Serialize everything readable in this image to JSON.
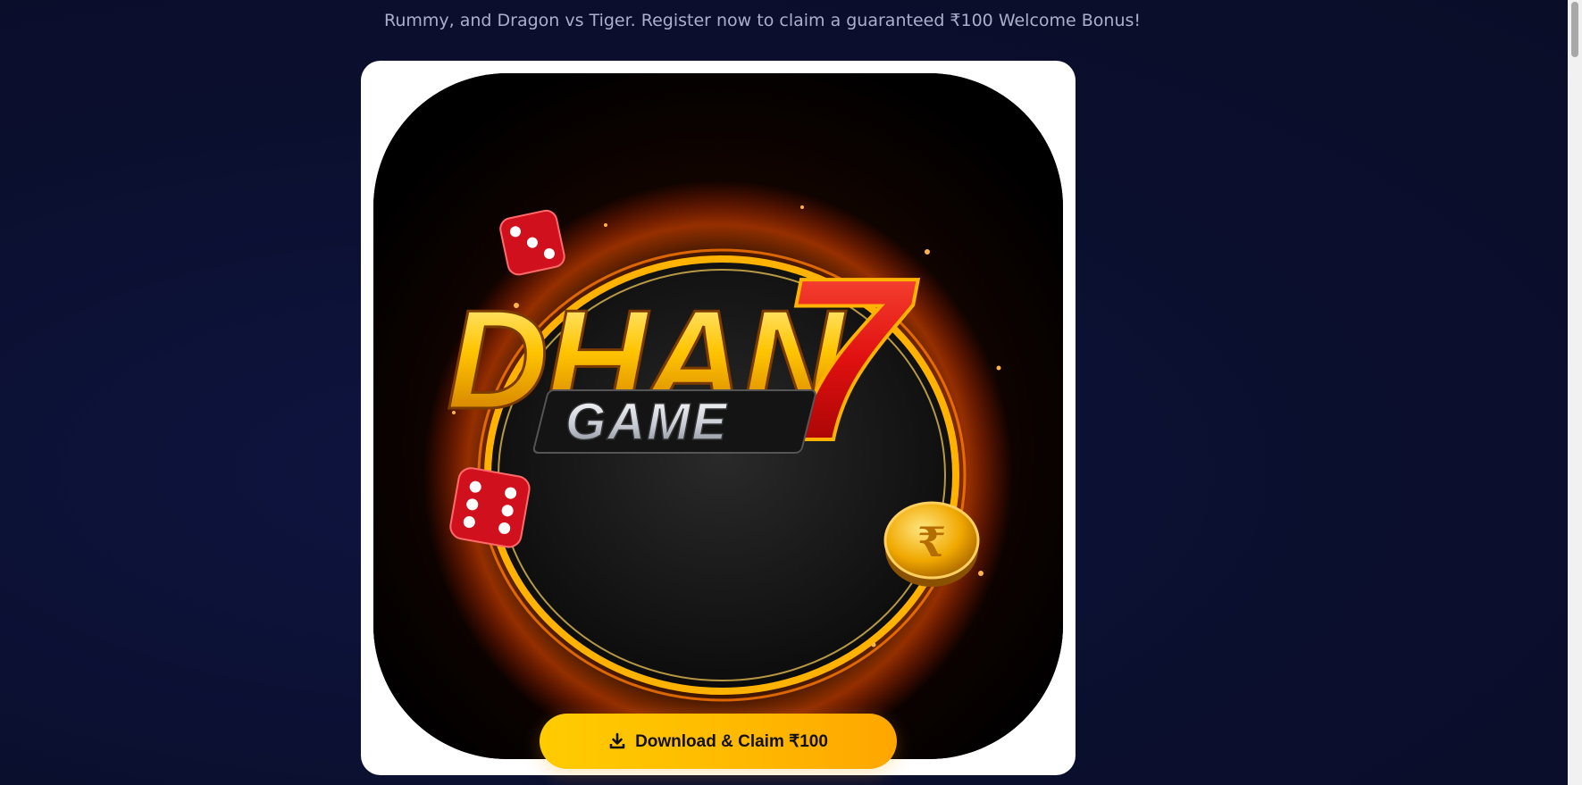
{
  "intro": {
    "text": "Rummy, and Dragon vs Tiger. Register now to claim a guaranteed ₹100 Welcome Bonus!"
  },
  "logo": {
    "brand_word": "DHAN",
    "brand_number": "7",
    "sub_word": "GAME",
    "coin_symbol": "₹"
  },
  "cta": {
    "label": "Download & Claim ₹100",
    "icon": "download-icon"
  },
  "colors": {
    "background": "#0b0f2e",
    "card": "#ffffff",
    "cta_gradient_start": "#ffcc00",
    "cta_gradient_end": "#ffa600",
    "logo_gold": "#ffb300",
    "logo_red": "#e01010"
  }
}
